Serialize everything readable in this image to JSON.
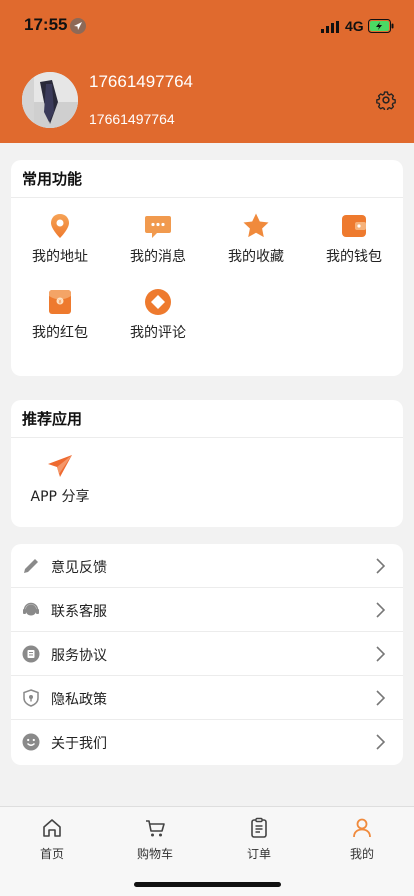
{
  "status": {
    "time": "17:55",
    "network": "4G"
  },
  "user": {
    "name": "17661497764",
    "account": "17661497764"
  },
  "common": {
    "title": "常用功能",
    "items": [
      {
        "label": "我的地址",
        "icon": "location-pin-icon"
      },
      {
        "label": "我的消息",
        "icon": "message-icon"
      },
      {
        "label": "我的收藏",
        "icon": "star-icon"
      },
      {
        "label": "我的钱包",
        "icon": "wallet-icon"
      },
      {
        "label": "我的红包",
        "icon": "red-envelope-icon"
      },
      {
        "label": "我的评论",
        "icon": "comment-icon"
      }
    ]
  },
  "recommend": {
    "title": "推荐应用",
    "items": [
      {
        "label": "APP 分享",
        "icon": "paper-plane-icon"
      }
    ]
  },
  "menu": [
    {
      "label": "意见反馈",
      "icon": "pencil-icon"
    },
    {
      "label": "联系客服",
      "icon": "headset-icon"
    },
    {
      "label": "服务协议",
      "icon": "document-icon"
    },
    {
      "label": "隐私政策",
      "icon": "shield-icon"
    },
    {
      "label": "关于我们",
      "icon": "smile-icon"
    }
  ],
  "tabs": [
    {
      "label": "首页",
      "icon": "home-icon"
    },
    {
      "label": "购物车",
      "icon": "cart-icon"
    },
    {
      "label": "订单",
      "icon": "order-icon"
    },
    {
      "label": "我的",
      "icon": "user-icon",
      "active": true
    }
  ],
  "colors": {
    "brand": "#e06a2e",
    "accent_orange": "#f08a3c",
    "tab_active": "#f08a3c"
  }
}
